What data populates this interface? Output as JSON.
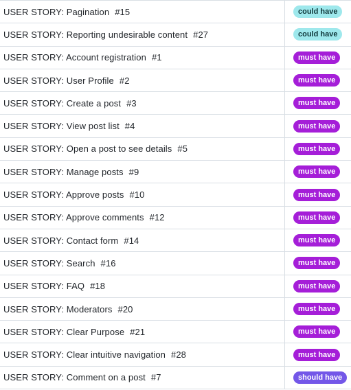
{
  "rows": [
    {
      "title": "USER STORY: Pagination",
      "number": "#15",
      "label": "could have",
      "label_kind": "could"
    },
    {
      "title": "USER STORY: Reporting undesirable content",
      "number": "#27",
      "label": "could have",
      "label_kind": "could"
    },
    {
      "title": "USER STORY: Account registration",
      "number": "#1",
      "label": "must have",
      "label_kind": "must"
    },
    {
      "title": "USER STORY: User Profile",
      "number": "#2",
      "label": "must have",
      "label_kind": "must"
    },
    {
      "title": "USER STORY: Create a post",
      "number": "#3",
      "label": "must have",
      "label_kind": "must"
    },
    {
      "title": "USER STORY: View post list",
      "number": "#4",
      "label": "must have",
      "label_kind": "must"
    },
    {
      "title": "USER STORY: Open a post to see details",
      "number": "#5",
      "label": "must have",
      "label_kind": "must"
    },
    {
      "title": "USER STORY: Manage posts",
      "number": "#9",
      "label": "must have",
      "label_kind": "must"
    },
    {
      "title": "USER STORY: Approve posts",
      "number": "#10",
      "label": "must have",
      "label_kind": "must"
    },
    {
      "title": "USER STORY: Approve comments",
      "number": "#12",
      "label": "must have",
      "label_kind": "must"
    },
    {
      "title": "USER STORY: Contact form",
      "number": "#14",
      "label": "must have",
      "label_kind": "must"
    },
    {
      "title": "USER STORY: Search",
      "number": "#16",
      "label": "must have",
      "label_kind": "must"
    },
    {
      "title": "USER STORY: FAQ",
      "number": "#18",
      "label": "must have",
      "label_kind": "must"
    },
    {
      "title": "USER STORY: Moderators",
      "number": "#20",
      "label": "must have",
      "label_kind": "must"
    },
    {
      "title": "USER STORY: Clear Purpose",
      "number": "#21",
      "label": "must have",
      "label_kind": "must"
    },
    {
      "title": "USER STORY: Clear intuitive navigation",
      "number": "#28",
      "label": "must have",
      "label_kind": "must"
    },
    {
      "title": "USER STORY: Comment on a post",
      "number": "#7",
      "label": "should have",
      "label_kind": "should"
    }
  ],
  "colors": {
    "could_have_bg": "#9ee8ec",
    "must_have_bg": "#a51ed8",
    "should_have_bg": "#7357e8",
    "border": "#d8dee4"
  }
}
